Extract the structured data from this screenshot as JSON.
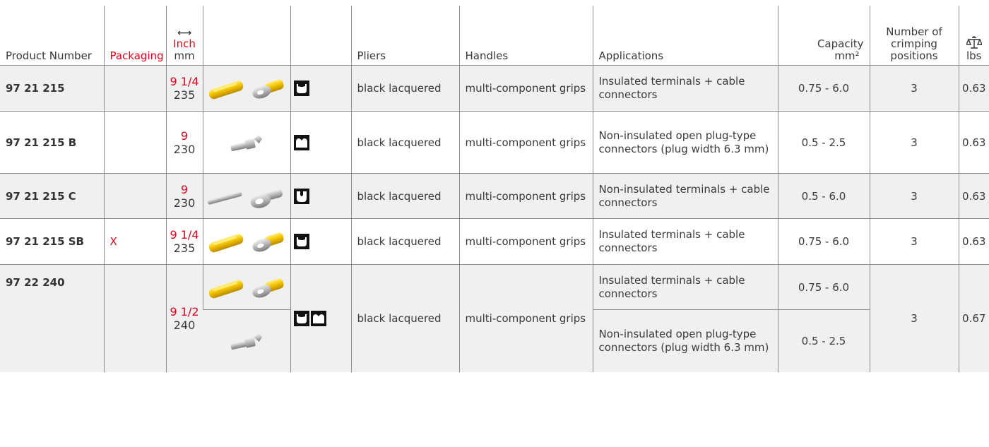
{
  "headers": {
    "product_number": "Product Number",
    "packaging": "Packaging",
    "size_inch": "Inch",
    "size_mm": "mm",
    "pliers": "Pliers",
    "handles": "Handles",
    "applications": "Applications",
    "capacity": "Capacity",
    "capacity_unit": "mm²",
    "positions": "Number of crimping positions",
    "weight_unit": "lbs"
  },
  "rows": [
    {
      "product": "97 21 215",
      "packaging": "",
      "inch": "9 1/4",
      "mm": "235",
      "image": "insulated-terminals-image",
      "profile": [
        "insulated-profile-icon"
      ],
      "pliers": "black lacquered",
      "handles": "multi-component grips",
      "application": "Insulated terminals + cable connectors",
      "capacity": "0.75 - 6.0",
      "positions": "3",
      "weight": "0.63"
    },
    {
      "product": "97 21 215 B",
      "packaging": "",
      "inch": "9",
      "mm": "230",
      "image": "open-plug-connector-image",
      "profile": [
        "open-plug-profile-icon"
      ],
      "pliers": "black lacquered",
      "handles": "multi-component grips",
      "application": "Non-insulated open plug-type connectors (plug width 6.3 mm)",
      "capacity": "0.5 - 2.5",
      "positions": "3",
      "weight": "0.63"
    },
    {
      "product": "97 21 215 C",
      "packaging": "",
      "inch": "9",
      "mm": "230",
      "image": "non-insulated-terminals-image",
      "profile": [
        "non-insulated-profile-icon"
      ],
      "pliers": "black lacquered",
      "handles": "multi-component grips",
      "application": "Non-insulated terminals + cable connectors",
      "capacity": "0.5 - 6.0",
      "positions": "3",
      "weight": "0.63"
    },
    {
      "product": "97 21 215 SB",
      "packaging": "X",
      "inch": "9 1/4",
      "mm": "235",
      "image": "insulated-terminals-image",
      "profile": [
        "insulated-profile-icon"
      ],
      "pliers": "black lacquered",
      "handles": "multi-component grips",
      "application": "Insulated terminals + cable connectors",
      "capacity": "0.75 - 6.0",
      "positions": "3",
      "weight": "0.63"
    }
  ],
  "last": {
    "product": "97 22 240",
    "packaging": "",
    "inch": "9 1/2",
    "mm": "240",
    "pliers": "black lacquered",
    "handles": "multi-component grips",
    "positions": "3",
    "weight": "0.67",
    "sub": [
      {
        "image": "insulated-terminals-image",
        "application": "Insulated terminals + cable connectors",
        "capacity": "0.75 - 6.0"
      },
      {
        "image": "open-plug-connector-image",
        "application": "Non-insulated open plug-type connectors (plug width 6.3 mm)",
        "capacity": "0.5 - 2.5"
      }
    ],
    "profiles": [
      "insulated-profile-icon",
      "open-plug-profile-icon"
    ]
  },
  "colors": {
    "accent_red": "#e2001a",
    "row_shade": "#f0f0f0",
    "grid": "#8c8c8c",
    "terminal_yellow": "#f5c400",
    "metal": "#b8b8b8"
  }
}
